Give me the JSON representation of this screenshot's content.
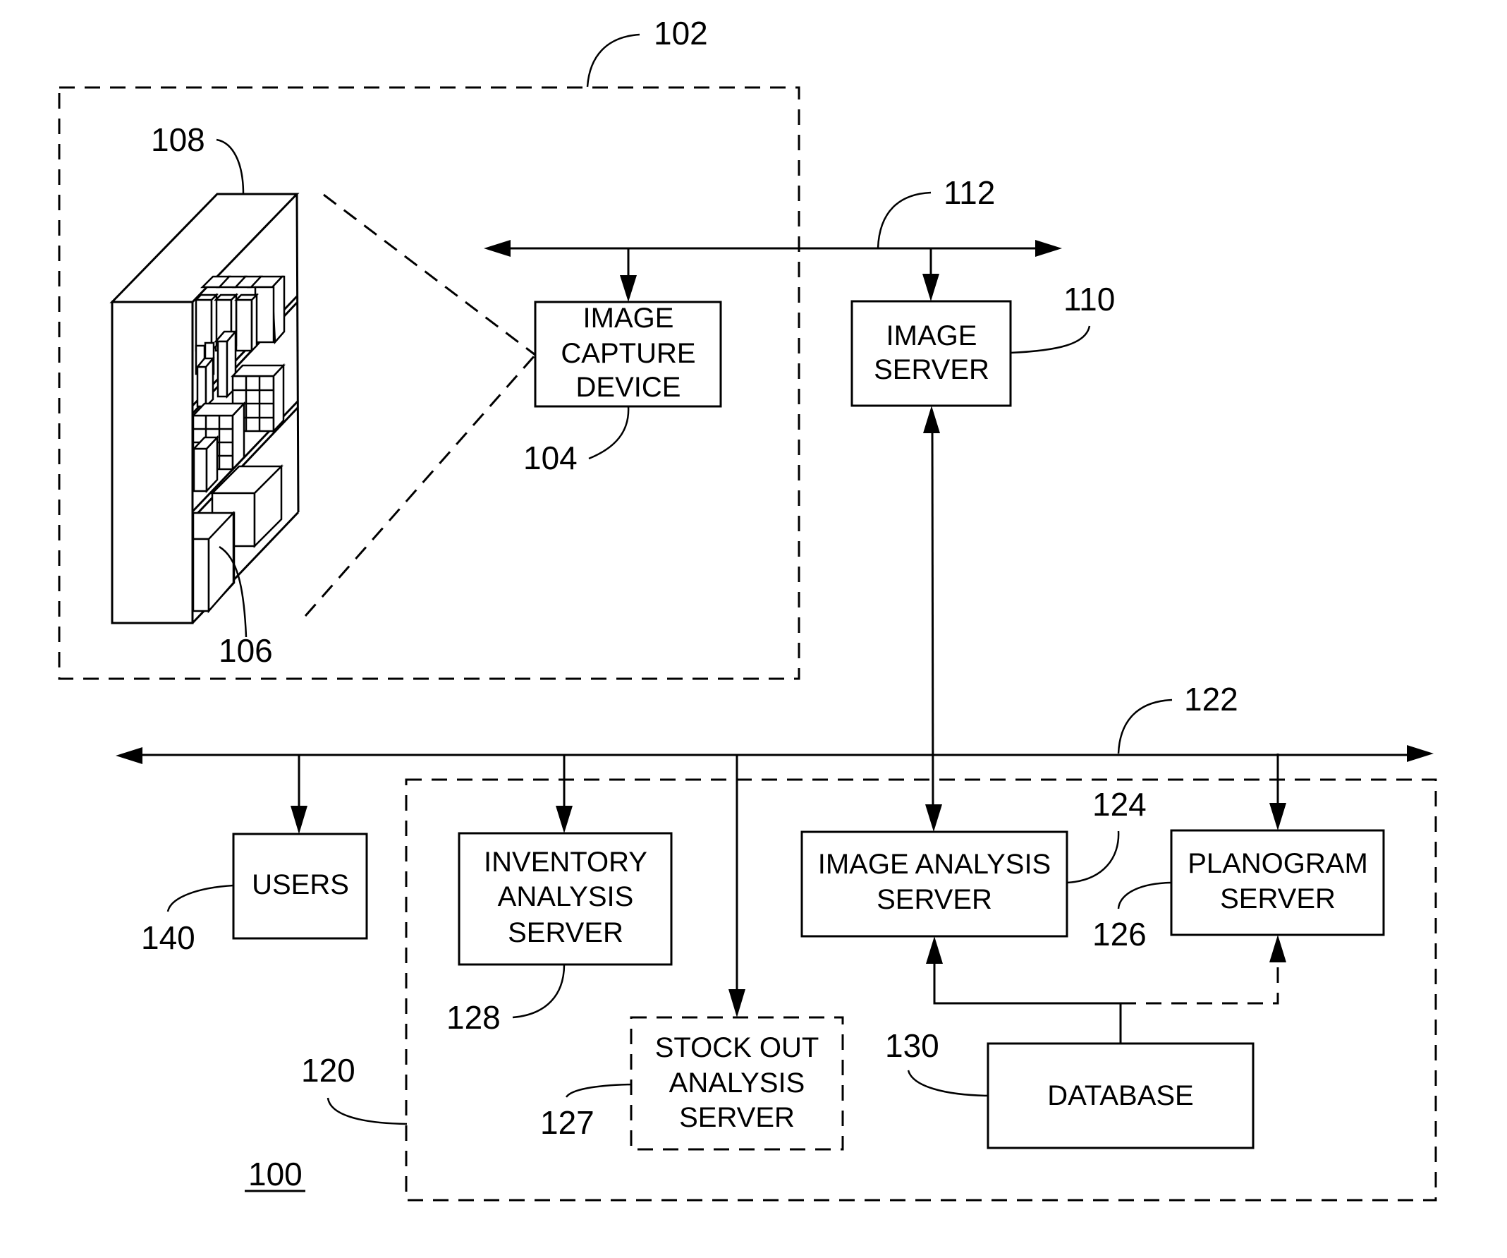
{
  "figure": {
    "figure_number": "100",
    "colors": {
      "line": "#000000",
      "background": "#ffffff"
    }
  },
  "store_area": {
    "ref": "102",
    "shelf": {
      "ref": "108",
      "name": "store shelf"
    },
    "product": {
      "ref": "106",
      "name": "product"
    },
    "image_capture_device": {
      "ref": "104",
      "lines": [
        "IMAGE",
        "CAPTURE",
        "DEVICE"
      ]
    }
  },
  "network_112": {
    "ref": "112"
  },
  "image_server": {
    "ref": "110",
    "lines": [
      "IMAGE",
      "SERVER"
    ]
  },
  "network_122": {
    "ref": "122"
  },
  "users": {
    "ref": "140",
    "lines": [
      "USERS"
    ]
  },
  "server_group": {
    "ref": "120",
    "inventory_analysis_server": {
      "ref": "128",
      "lines": [
        "INVENTORY",
        "ANALYSIS",
        "SERVER"
      ]
    },
    "stock_out_analysis_server": {
      "ref": "127",
      "lines": [
        "STOCK OUT",
        "ANALYSIS",
        "SERVER"
      ]
    },
    "image_analysis_server": {
      "ref": "124",
      "lines": [
        "IMAGE ANALYSIS",
        "SERVER"
      ]
    },
    "planogram_server": {
      "ref": "126",
      "lines": [
        "PLANOGRAM",
        "SERVER"
      ]
    },
    "database": {
      "ref": "130",
      "lines": [
        "DATABASE"
      ]
    }
  }
}
